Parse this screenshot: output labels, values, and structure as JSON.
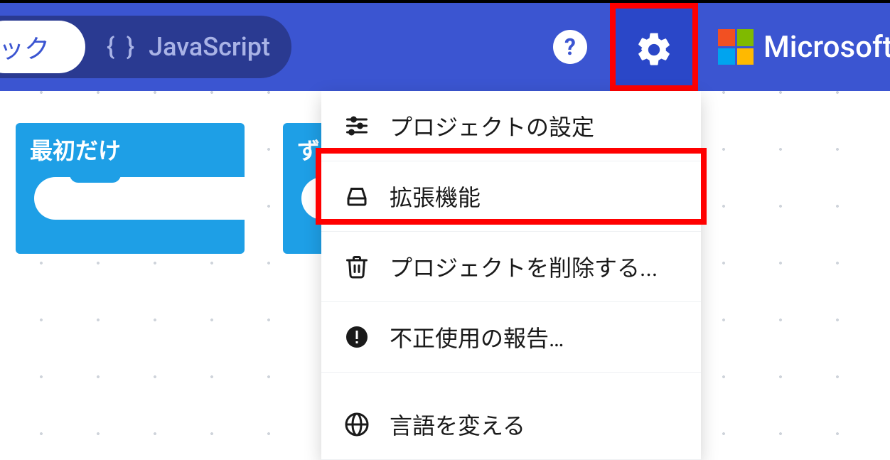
{
  "header": {
    "tab_blocks_label": "ック",
    "tab_js_label": "JavaScript",
    "brand_label": "Microsoft"
  },
  "canvas": {
    "block1_label": "最初だけ",
    "block2_label": "ず"
  },
  "menu": {
    "project_settings": "プロジェクトの設定",
    "extensions": "拡張機能",
    "delete_project": "プロジェクトを削除する...",
    "report_abuse": "不正使用の報告…",
    "change_language": "言語を変える"
  }
}
